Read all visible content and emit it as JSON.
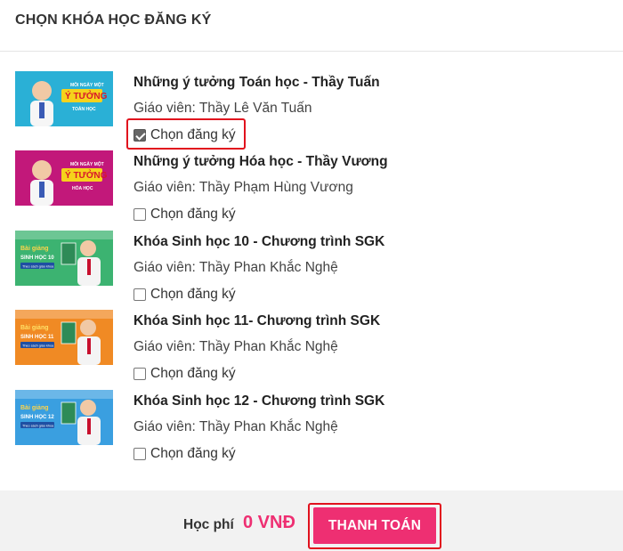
{
  "header": {
    "title": "CHỌN KHÓA HỌC ĐĂNG KÝ"
  },
  "courses": [
    {
      "title": "Những ý tưởng Toán học - Thầy Tuấn",
      "teacher": "Giáo viên: Thầy Lê Văn Tuấn",
      "checkbox_label": "Chọn đăng ký",
      "checked": true,
      "thumb_text": [
        "MỖI NGÀY MỘT",
        "Ý TƯỞNG",
        "TOÁN HỌC"
      ],
      "thumb_colors": {
        "bg": "#2ab0d6",
        "accent": "#f5d21c"
      }
    },
    {
      "title": "Những ý tưởng Hóa học - Thầy Vương",
      "teacher": "Giáo viên: Thầy Phạm Hùng Vương",
      "checkbox_label": "Chọn đăng ký",
      "checked": false,
      "thumb_text": [
        "MỖI NGÀY MỘT",
        "Ý TƯỞNG",
        "HÓA HỌC"
      ],
      "thumb_colors": {
        "bg": "#c2187a",
        "accent": "#f5d21c"
      }
    },
    {
      "title": "Khóa Sinh học 10 - Chương trình SGK",
      "teacher": "Giáo viên: Thầy Phan Khắc Nghệ",
      "checkbox_label": "Chọn đăng ký",
      "checked": false,
      "thumb_text": [
        "Bài giảng",
        "SINH HỌC 10",
        "Theo sách giáo khoa"
      ],
      "thumb_colors": {
        "bg": "#3cb371",
        "accent": "#ffd54a"
      }
    },
    {
      "title": "Khóa Sinh học 11- Chương trình SGK",
      "teacher": "Giáo viên: Thầy Phan Khắc Nghệ",
      "checkbox_label": "Chọn đăng ký",
      "checked": false,
      "thumb_text": [
        "Bài giảng",
        "SINH HỌC 11",
        "Theo sách giáo khoa"
      ],
      "thumb_colors": {
        "bg": "#f08a24",
        "accent": "#ffe066"
      }
    },
    {
      "title": "Khóa Sinh học 12 - Chương trình SGK",
      "teacher": "Giáo viên: Thầy Phan Khắc Nghệ",
      "checkbox_label": "Chọn đăng ký",
      "checked": false,
      "thumb_text": [
        "Bài giảng",
        "SINH HỌC 12",
        "Theo sách giáo khoa"
      ],
      "thumb_colors": {
        "bg": "#3a9fe0",
        "accent": "#ffd54a"
      }
    }
  ],
  "footer": {
    "fee_label": "Học phí",
    "fee_value": "0 VNĐ",
    "pay_button": "THANH TOÁN"
  },
  "colors": {
    "brand_pink": "#ee2f72",
    "highlight_red": "#e1111d"
  }
}
